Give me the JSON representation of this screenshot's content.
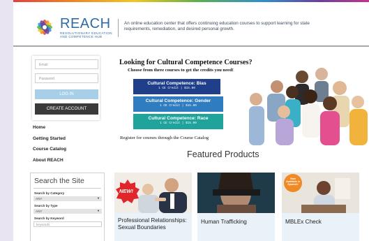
{
  "header": {
    "logo_word": "REACH",
    "logo_tagline": "RESOLUTIONARY EDUCATION AND COMPETENCE HUB",
    "description": "An online education center that offers continuing education courses to support learning for state requirements, remediation, and desired personal growth."
  },
  "login": {
    "email_placeholder": "Email",
    "password_placeholder": "Password",
    "login_label": "LOG IN",
    "create_label": "CREATE ACCOUNT"
  },
  "nav": {
    "items": [
      "Home",
      "Getting Started",
      "Course Catalog",
      "About REACH"
    ]
  },
  "search": {
    "title": "Search the Site",
    "category_label": "Search by Category",
    "category_value": "ANY",
    "type_label": "Search by Type",
    "type_value": "ANY",
    "keyword_label": "Search by Keyword",
    "keyword_placeholder": "keywords"
  },
  "banner": {
    "title": "Looking for Cultural Competence Courses?",
    "subtitle": "Choose from three courses to get the credits you need!",
    "courses": [
      {
        "title": "Cultural Competence: Bias",
        "credit": "1 CE Credit | $15.00",
        "color": "#1f3f8a"
      },
      {
        "title": "Cultural Competence: Gender",
        "credit": "1 CE Credit | $15.00",
        "color": "#2f7cc0"
      },
      {
        "title": "Cultural Competence: Race",
        "credit": "1 CE Credit | $15.00",
        "color": "#1fa39a"
      }
    ],
    "footer": "Register for courses through the Course Catalog"
  },
  "featured": {
    "title": "Featured Products",
    "products": [
      {
        "title": "Professional Relationships: Sexual Boundaries",
        "badge": "NEW!"
      },
      {
        "title": "Human Trafficking",
        "badge": ""
      },
      {
        "title": "MBLEx Check",
        "badge": "Now Available in Spanish!"
      }
    ]
  },
  "colors": {
    "brand_blue": "#2d6aa6",
    "login_button": "#a7cfe8",
    "create_button": "#3a3a3a",
    "card_bg": "#eaf2f9"
  }
}
